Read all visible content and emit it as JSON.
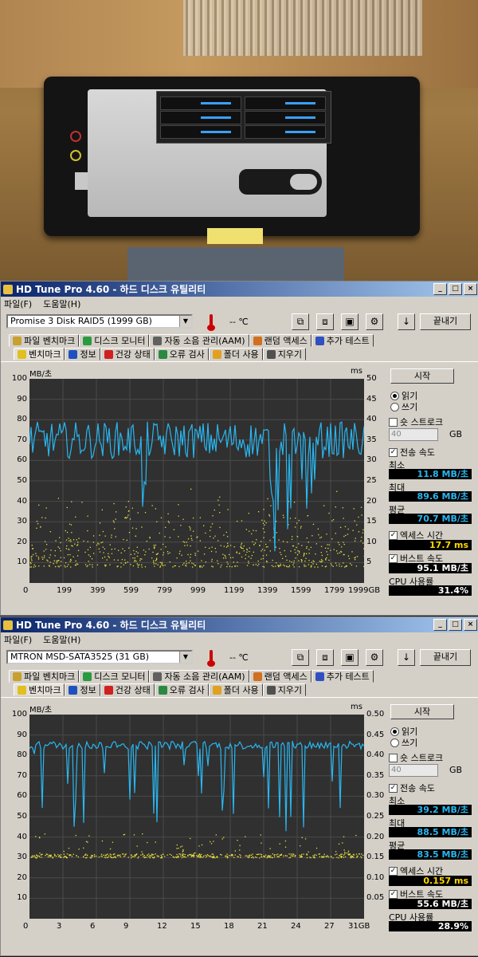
{
  "windows": [
    {
      "title": "HD Tune Pro 4.60 - 하드 디스크 유틸리티",
      "menu": [
        "파일(F)",
        "도움말(H)"
      ],
      "drive": "Promise 3 Disk RAID5     (1999 GB)",
      "temperature": "-- ℃",
      "exit_label": "끝내기",
      "tabs_top": [
        "파일 벤치마크",
        "디스크 모니터",
        "자동 소음 관리(AAM)",
        "랜덤 액세스",
        "추가 테스트"
      ],
      "tabs_bottom": [
        "벤치마크",
        "정보",
        "건강 상태",
        "오류 검사",
        "폴더 사용",
        "지우기"
      ],
      "active_tab": "벤치마크",
      "panel": {
        "start_label": "시작",
        "read_label": "읽기",
        "write_label": "쓰기",
        "short_stroke_label": "숏 스트로크",
        "short_stroke_value": "40",
        "gb_label": "GB",
        "transfer_label": "전송 속도",
        "min_label": "최소",
        "min_value": "11.8 MB/초",
        "max_label": "최대",
        "max_value": "89.6 MB/초",
        "avg_label": "평균",
        "avg_value": "70.7 MB/초",
        "access_label": "엑세스 시간",
        "access_value": "17.7 ms",
        "burst_label": "버스트 속도",
        "burst_value": "95.1 MB/초",
        "cpu_label": "CPU 사용률",
        "cpu_value": "31.4%"
      },
      "chart": {
        "ylabel_left": "MB/초",
        "ylabel_right": "ms",
        "left_ticks": [
          "100",
          "90",
          "80",
          "70",
          "60",
          "50",
          "40",
          "30",
          "20",
          "10"
        ],
        "right_ticks": [
          "50",
          "45",
          "40",
          "35",
          "30",
          "25",
          "20",
          "15",
          "10",
          "5"
        ],
        "x_ticks": [
          "0",
          "199",
          "399",
          "599",
          "799",
          "999",
          "1199",
          "1399",
          "1599",
          "1799",
          "1999GB"
        ]
      }
    },
    {
      "title": "HD Tune Pro 4.60 - 하드 디스크 유틸리티",
      "menu": [
        "파일(F)",
        "도움말(H)"
      ],
      "drive": "MTRON MSD-SATA3525 (31 GB)",
      "temperature": "-- ℃",
      "exit_label": "끝내기",
      "tabs_top": [
        "파일 벤치마크",
        "디스크 모니터",
        "자동 소음 관리(AAM)",
        "랜덤 액세스",
        "추가 테스트"
      ],
      "tabs_bottom": [
        "벤치마크",
        "정보",
        "건강 상태",
        "오류 검사",
        "폴더 사용",
        "지우기"
      ],
      "active_tab": "벤치마크",
      "panel": {
        "start_label": "시작",
        "read_label": "읽기",
        "write_label": "쓰기",
        "short_stroke_label": "숏 스트로크",
        "short_stroke_value": "40",
        "gb_label": "GB",
        "transfer_label": "전송 속도",
        "min_label": "최소",
        "min_value": "39.2 MB/초",
        "max_label": "최대",
        "max_value": "88.5 MB/초",
        "avg_label": "평균",
        "avg_value": "83.5 MB/초",
        "access_label": "엑세스 시간",
        "access_value": "0.157 ms",
        "burst_label": "버스트 속도",
        "burst_value": "55.6 MB/초",
        "cpu_label": "CPU 사용률",
        "cpu_value": "28.9%"
      },
      "chart": {
        "ylabel_left": "MB/초",
        "ylabel_right": "ms",
        "left_ticks": [
          "100",
          "90",
          "80",
          "70",
          "60",
          "50",
          "40",
          "30",
          "20",
          "10"
        ],
        "right_ticks": [
          "0.50",
          "0.45",
          "0.40",
          "0.35",
          "0.30",
          "0.25",
          "0.20",
          "0.15",
          "0.10",
          "0.05"
        ],
        "x_ticks": [
          "0",
          "3",
          "6",
          "9",
          "12",
          "15",
          "18",
          "21",
          "24",
          "27",
          "31GB"
        ]
      }
    }
  ],
  "colors": {
    "transfer_line": "#29b6f0",
    "access_dots": "#e8e040",
    "graph_bg": "#303030",
    "grid": "#4a4a4a",
    "title_start": "#0a246a",
    "title_end": "#a6caf0"
  }
}
